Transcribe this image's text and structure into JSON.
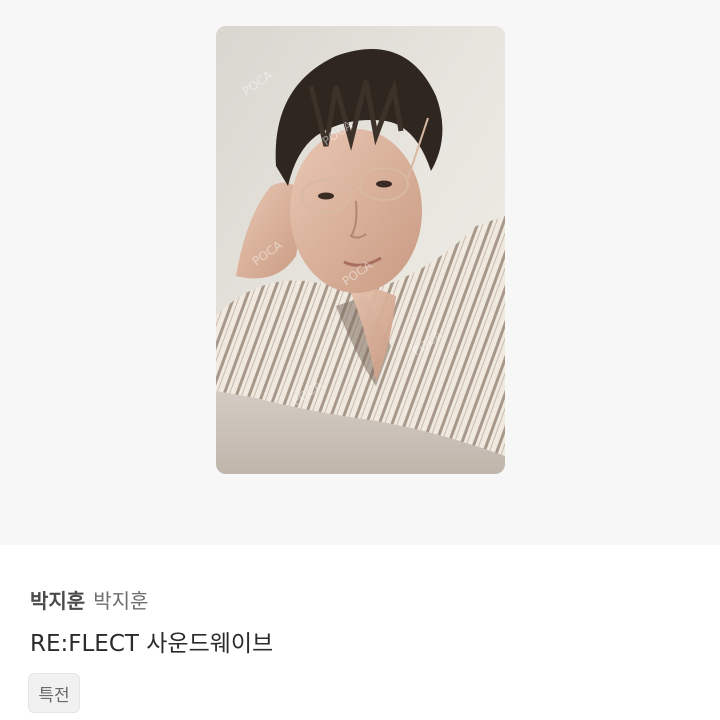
{
  "item": {
    "artist_primary": "박지훈",
    "artist_secondary": "박지훈",
    "title": "RE:FLECT 사운드웨이브",
    "tag": "특전"
  },
  "photo": {
    "watermark": "POCA"
  },
  "colors": {
    "image_background": "#f7f7f7",
    "info_background": "#ffffff",
    "tag_background": "#f1f1f1"
  }
}
